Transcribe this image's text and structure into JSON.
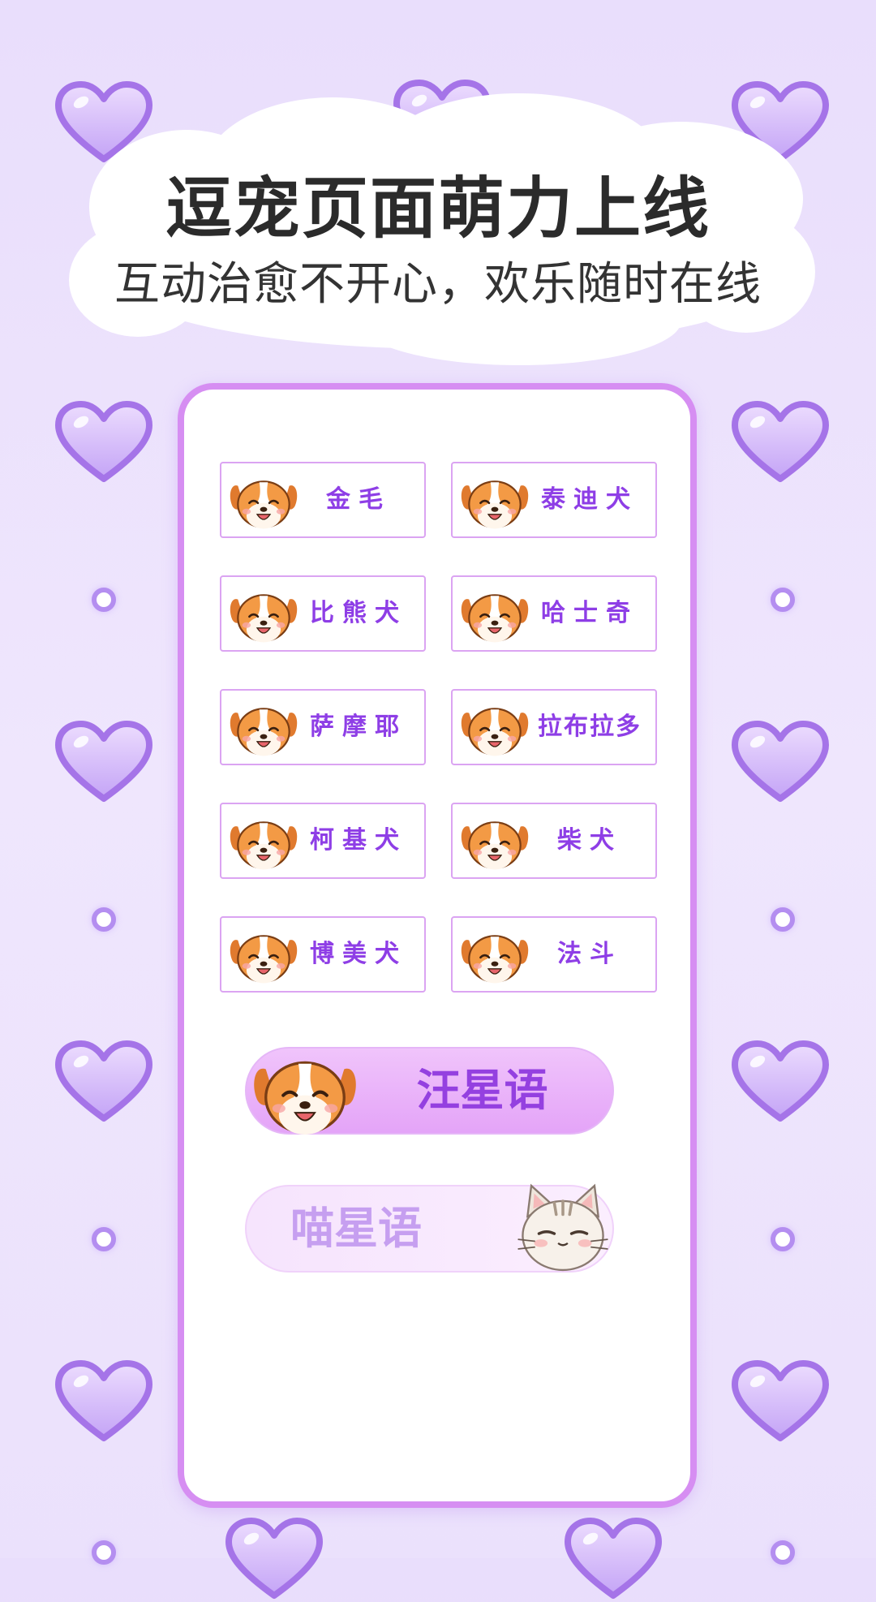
{
  "header": {
    "title": "逗宠页面萌力上线",
    "subtitle": "互动治愈不开心，欢乐随时在线"
  },
  "breeds": [
    {
      "label": "金毛",
      "icon": "dog-face-icon"
    },
    {
      "label": "泰迪犬",
      "icon": "dog-face-icon"
    },
    {
      "label": "比熊犬",
      "icon": "dog-face-icon"
    },
    {
      "label": "哈士奇",
      "icon": "dog-face-icon"
    },
    {
      "label": "萨摩耶",
      "icon": "dog-face-icon"
    },
    {
      "label": "拉布拉多",
      "icon": "dog-face-icon"
    },
    {
      "label": "柯基犬",
      "icon": "dog-face-icon"
    },
    {
      "label": "柴犬",
      "icon": "dog-face-icon"
    },
    {
      "label": "博美犬",
      "icon": "dog-face-icon"
    },
    {
      "label": "法斗",
      "icon": "dog-face-icon"
    }
  ],
  "language_buttons": {
    "dog": {
      "label": "汪星语",
      "icon": "dog-face-icon",
      "selected": true
    },
    "cat": {
      "label": "喵星语",
      "icon": "cat-face-icon",
      "selected": false
    }
  },
  "colors": {
    "background": "#ece2fc",
    "panel_border": "#d68ef2",
    "accent_text": "#8e3ee6",
    "heart": "#b48ef0"
  }
}
